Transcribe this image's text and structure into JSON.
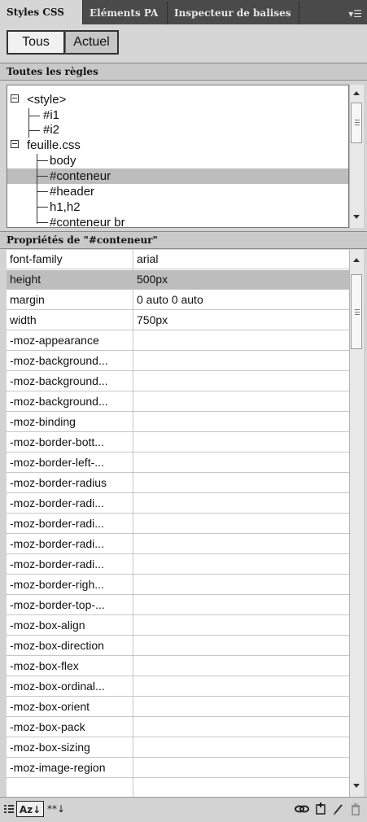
{
  "tabs": [
    "Styles CSS",
    "Eléments PA",
    "Inspecteur de balises"
  ],
  "tab_menu_icon": "panel-menu-icon",
  "mode": {
    "all": "Tous",
    "current": "Actuel"
  },
  "rules_section": {
    "title": "Toutes les règles"
  },
  "tree": {
    "style": "<style>",
    "i1": "#i1",
    "i2": "#i2",
    "sheet": "feuille.css",
    "body": "body",
    "conteneur": "#conteneur",
    "header": "#header",
    "h1h2": "h1,h2",
    "conteneur_br": "#conteneur br"
  },
  "props_section": {
    "title": "Propriétés de \"#conteneur\""
  },
  "properties": [
    {
      "name": "font-family",
      "value": "arial"
    },
    {
      "name": "height",
      "value": "500px",
      "selected": true
    },
    {
      "name": "margin",
      "value": "0 auto 0 auto"
    },
    {
      "name": "width",
      "value": "750px"
    },
    {
      "name": "-moz-appearance",
      "value": ""
    },
    {
      "name": "-moz-background...",
      "value": ""
    },
    {
      "name": "-moz-background...",
      "value": ""
    },
    {
      "name": "-moz-background...",
      "value": ""
    },
    {
      "name": "-moz-binding",
      "value": ""
    },
    {
      "name": "-moz-border-bott...",
      "value": ""
    },
    {
      "name": "-moz-border-left-...",
      "value": ""
    },
    {
      "name": "-moz-border-radius",
      "value": ""
    },
    {
      "name": "-moz-border-radi...",
      "value": ""
    },
    {
      "name": "-moz-border-radi...",
      "value": ""
    },
    {
      "name": "-moz-border-radi...",
      "value": ""
    },
    {
      "name": "-moz-border-radi...",
      "value": ""
    },
    {
      "name": "-moz-border-righ...",
      "value": ""
    },
    {
      "name": "-moz-border-top-...",
      "value": ""
    },
    {
      "name": "-moz-box-align",
      "value": ""
    },
    {
      "name": "-moz-box-direction",
      "value": ""
    },
    {
      "name": "-moz-box-flex",
      "value": ""
    },
    {
      "name": "-moz-box-ordinal...",
      "value": ""
    },
    {
      "name": "-moz-box-orient",
      "value": ""
    },
    {
      "name": "-moz-box-pack",
      "value": ""
    },
    {
      "name": "-moz-box-sizing",
      "value": ""
    },
    {
      "name": "-moz-image-region",
      "value": ""
    }
  ],
  "bottom_toolbar": {
    "category_view": "category-view-icon",
    "az_view": "Az↓",
    "set_props_only": "**↓",
    "attach_icon": "attach-stylesheet-icon",
    "new_rule_icon": "new-css-rule-icon",
    "edit_icon": "edit-style-icon",
    "delete_icon": "delete-css-rule-icon"
  }
}
